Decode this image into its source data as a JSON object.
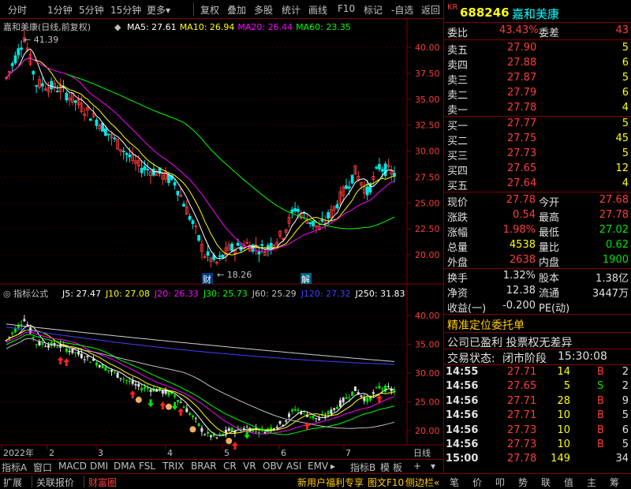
{
  "toolbar": {
    "left_items": [
      "分时",
      "1分钟",
      "5分钟",
      "15分钟",
      "更多"
    ],
    "more_arrow": "▾",
    "right_items": [
      "复权",
      "叠加",
      "多股",
      "统计",
      "画线",
      "F10",
      "标记",
      "-自选",
      "返回"
    ]
  },
  "main_chart": {
    "stock_label": "嘉和美康(日线,前复权)",
    "ma": [
      {
        "label": "MA5: 27.61",
        "color": "#ffffff"
      },
      {
        "label": "MA10: 26.94",
        "color": "#ffff00"
      },
      {
        "label": "MA20: 26.44",
        "color": "#ff00ff"
      },
      {
        "label": "MA60: 23.35",
        "color": "#00ff00"
      }
    ],
    "price_axis": [
      "40.00",
      "37.50",
      "35.00",
      "32.50",
      "30.00",
      "27.50",
      "25.00",
      "22.50",
      "20.00"
    ],
    "high_marker": "41.39",
    "low_marker": "18.26",
    "event_markers": [
      "财",
      "解"
    ]
  },
  "indicator": {
    "label": "指标公式",
    "values": [
      {
        "label": "J5: 27.47",
        "color": "#ffffff"
      },
      {
        "label": "J10: 27.08",
        "color": "#ffff00"
      },
      {
        "label": "J20: 26.33",
        "color": "#ff00ff"
      },
      {
        "label": "J30: 25.73",
        "color": "#00ff00"
      },
      {
        "label": "J60: 25.29",
        "color": "#c0c0c0"
      },
      {
        "label": "J120: 27.32",
        "color": "#4040ff"
      },
      {
        "label": "J250: 31.83",
        "color": "#ffffff"
      }
    ],
    "axis": [
      "40.00",
      "35.00",
      "30.00",
      "25.00",
      "20.00"
    ]
  },
  "date_axis": [
    "2022年",
    "2",
    "3",
    "4",
    "5",
    "6",
    "7"
  ],
  "date_axis_right": "日线",
  "bottom_tabs": [
    "指标A",
    "窗口",
    "MACD",
    "DMI",
    "DMA",
    "FSL",
    "TRIX",
    "BRAR",
    "CR",
    "VR",
    "OBV",
    "ASI",
    "EMV",
    "指标B",
    "模",
    "板"
  ],
  "bottom_tab_arrows": [
    "▸",
    "+",
    "▾"
  ],
  "status_bar": {
    "left": [
      "扩展",
      "关联报价",
      "财富圈"
    ],
    "mid": [
      "新用户福利专享",
      "图文F10",
      "侧边栏"
    ],
    "right_icons": [
      "笔",
      "价",
      "叩",
      "势",
      "联",
      "值",
      "主",
      "筹"
    ]
  },
  "quote": {
    "market_tag": "KR",
    "code": "688246",
    "name": "嘉和美康",
    "weibi_label": "委比",
    "weibi_value": "43.43%",
    "weicha_label": "委差",
    "weicha_value": "43",
    "asks": [
      {
        "label": "卖五",
        "price": "27.90",
        "vol": "5"
      },
      {
        "label": "卖四",
        "price": "27.88",
        "vol": "6"
      },
      {
        "label": "卖三",
        "price": "27.87",
        "vol": "5"
      },
      {
        "label": "卖二",
        "price": "27.79",
        "vol": "6"
      },
      {
        "label": "卖一",
        "price": "27.78",
        "vol": "4"
      }
    ],
    "bids": [
      {
        "label": "买一",
        "price": "27.77",
        "vol": "5"
      },
      {
        "label": "买二",
        "price": "27.75",
        "vol": "45"
      },
      {
        "label": "买三",
        "price": "27.73",
        "vol": "5"
      },
      {
        "label": "买四",
        "price": "27.65",
        "vol": "12"
      },
      {
        "label": "买五",
        "price": "27.64",
        "vol": "4"
      }
    ],
    "stats": [
      {
        "l1": "现价",
        "v1": "27.78",
        "c1": "red",
        "l2": "今开",
        "v2": "27.68",
        "c2": "red"
      },
      {
        "l1": "涨跌",
        "v1": "0.54",
        "c1": "red",
        "l2": "最高",
        "v2": "27.78",
        "c2": "red"
      },
      {
        "l1": "涨幅",
        "v1": "1.98%",
        "c1": "red",
        "l2": "最低",
        "v2": "27.02",
        "c2": "green"
      },
      {
        "l1": "总量",
        "v1": "4538",
        "c1": "yellow",
        "l2": "量比",
        "v2": "0.62",
        "c2": "green"
      },
      {
        "l1": "外盘",
        "v1": "2638",
        "c1": "red",
        "l2": "内盘",
        "v2": "1900",
        "c2": "green"
      }
    ],
    "stats2": [
      {
        "l1": "换手",
        "v1": "1.32%",
        "l2": "股本",
        "v2": "1.38亿"
      },
      {
        "l1": "净资",
        "v1": "12.38",
        "l2": "流通",
        "v2": "3447万"
      },
      {
        "l1": "收益(一)",
        "v1": "-0.200",
        "l2": "PE(动)",
        "v2": ""
      }
    ],
    "promo": "精准定位委托单",
    "company_note": "公司已盈利 投票权无差异",
    "trade_status_label": "交易状态:",
    "trade_status_value": "闭市阶段",
    "trade_status_time": "15:30:08",
    "ticks": [
      {
        "time": "14:55",
        "price": "27.71",
        "vol": "14",
        "side": "B",
        "n": "2"
      },
      {
        "time": "14:56",
        "price": "27.65",
        "vol": "5",
        "side": "S",
        "n": "2"
      },
      {
        "time": "14:56",
        "price": "27.71",
        "vol": "28",
        "side": "B",
        "n": "9"
      },
      {
        "time": "14:56",
        "price": "27.71",
        "vol": "10",
        "side": "B",
        "n": "5"
      },
      {
        "time": "14:56",
        "price": "27.73",
        "vol": "10",
        "side": "B",
        "n": "6"
      },
      {
        "time": "14:56",
        "price": "27.73",
        "vol": "10",
        "side": "B",
        "n": "5"
      },
      {
        "time": "15:00",
        "price": "27.78",
        "vol": "149",
        "side": "",
        "n": "34"
      }
    ]
  },
  "colors": {
    "up": "#ff3c3c",
    "down": "#00e600",
    "frame": "#800000"
  }
}
